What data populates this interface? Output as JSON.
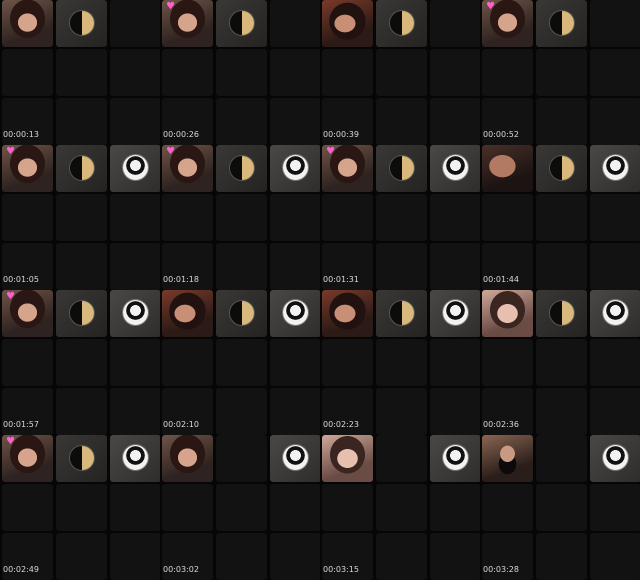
{
  "sheet": {
    "heart_glyph": "♥",
    "layout_classes": [
      [
        "face",
        "avatar-gold",
        "empty",
        "empty",
        "empty",
        "empty",
        "empty",
        "empty",
        "empty"
      ],
      [
        "face",
        "avatar-gold",
        "avatar-bw",
        "empty",
        "empty",
        "empty",
        "empty",
        "empty",
        "empty"
      ],
      [
        "face",
        "avatar-gold",
        "avatar-bw",
        "empty",
        "empty",
        "empty",
        "empty",
        "empty",
        "empty"
      ],
      [
        "face",
        "avatar-gold",
        "avatar-bw",
        "empty",
        "empty",
        "empty",
        "empty",
        "empty",
        "empty"
      ]
    ],
    "cells": [
      {
        "timestamp": "",
        "tiles": [
          "face",
          "avatar-gold",
          "empty",
          "empty",
          "empty",
          "empty",
          "empty",
          "empty",
          "empty"
        ],
        "heart": false
      },
      {
        "timestamp": "",
        "tiles": [
          "face",
          "avatar-gold",
          "empty",
          "empty",
          "empty",
          "empty",
          "empty",
          "empty",
          "empty"
        ],
        "heart": true
      },
      {
        "timestamp": "",
        "tiles": [
          "face warm",
          "avatar-gold",
          "empty",
          "empty",
          "empty",
          "empty",
          "empty",
          "empty",
          "empty"
        ],
        "heart": false
      },
      {
        "timestamp": "",
        "tiles": [
          "face",
          "avatar-gold",
          "empty",
          "empty",
          "empty",
          "empty",
          "empty",
          "empty",
          "empty"
        ],
        "heart": true
      },
      {
        "timestamp": "00:00:13",
        "tiles": [
          "face",
          "avatar-gold",
          "avatar-bw",
          "empty",
          "empty",
          "empty",
          "empty",
          "empty",
          "empty"
        ],
        "heart": true
      },
      {
        "timestamp": "00:00:26",
        "tiles": [
          "face",
          "avatar-gold",
          "avatar-bw",
          "empty",
          "empty",
          "empty",
          "empty",
          "empty",
          "empty"
        ],
        "heart": true
      },
      {
        "timestamp": "00:00:39",
        "tiles": [
          "face",
          "avatar-gold",
          "avatar-bw",
          "empty",
          "empty",
          "empty",
          "empty",
          "empty",
          "empty"
        ],
        "heart": true
      },
      {
        "timestamp": "00:00:52",
        "tiles": [
          "face blurry",
          "avatar-gold",
          "avatar-bw",
          "empty",
          "empty",
          "empty",
          "empty",
          "empty",
          "empty"
        ],
        "heart": false
      },
      {
        "timestamp": "00:01:05",
        "tiles": [
          "face",
          "avatar-gold",
          "avatar-bw",
          "empty",
          "empty",
          "empty",
          "empty",
          "empty",
          "empty"
        ],
        "heart": true
      },
      {
        "timestamp": "00:01:18",
        "tiles": [
          "face warm",
          "avatar-gold",
          "avatar-bw",
          "empty",
          "empty",
          "empty",
          "empty",
          "empty",
          "empty"
        ],
        "heart": false
      },
      {
        "timestamp": "00:01:31",
        "tiles": [
          "face warm",
          "avatar-gold",
          "avatar-bw",
          "empty",
          "empty",
          "empty",
          "empty",
          "empty",
          "empty"
        ],
        "heart": false
      },
      {
        "timestamp": "00:01:44",
        "tiles": [
          "face pale",
          "avatar-gold",
          "avatar-bw",
          "empty",
          "empty",
          "empty",
          "empty",
          "empty",
          "empty"
        ],
        "heart": false
      },
      {
        "timestamp": "00:01:57",
        "tiles": [
          "face",
          "avatar-gold",
          "avatar-bw",
          "empty",
          "empty",
          "empty",
          "empty",
          "empty",
          "empty"
        ],
        "heart": true
      },
      {
        "timestamp": "00:02:10",
        "tiles": [
          "face",
          "empty",
          "avatar-bw",
          "empty",
          "empty",
          "empty",
          "empty",
          "empty",
          "empty"
        ],
        "heart": false
      },
      {
        "timestamp": "00:02:23",
        "tiles": [
          "face pale",
          "empty",
          "avatar-bw",
          "empty",
          "empty",
          "empty",
          "empty",
          "empty",
          "empty"
        ],
        "heart": false
      },
      {
        "timestamp": "00:02:36",
        "tiles": [
          "face dark",
          "empty",
          "avatar-bw",
          "empty",
          "empty",
          "empty",
          "empty",
          "empty",
          "empty"
        ],
        "heart": false
      }
    ],
    "bottom_labels": [
      "00:02:49",
      "00:03:02",
      "00:03:15",
      "00:03:28"
    ]
  }
}
